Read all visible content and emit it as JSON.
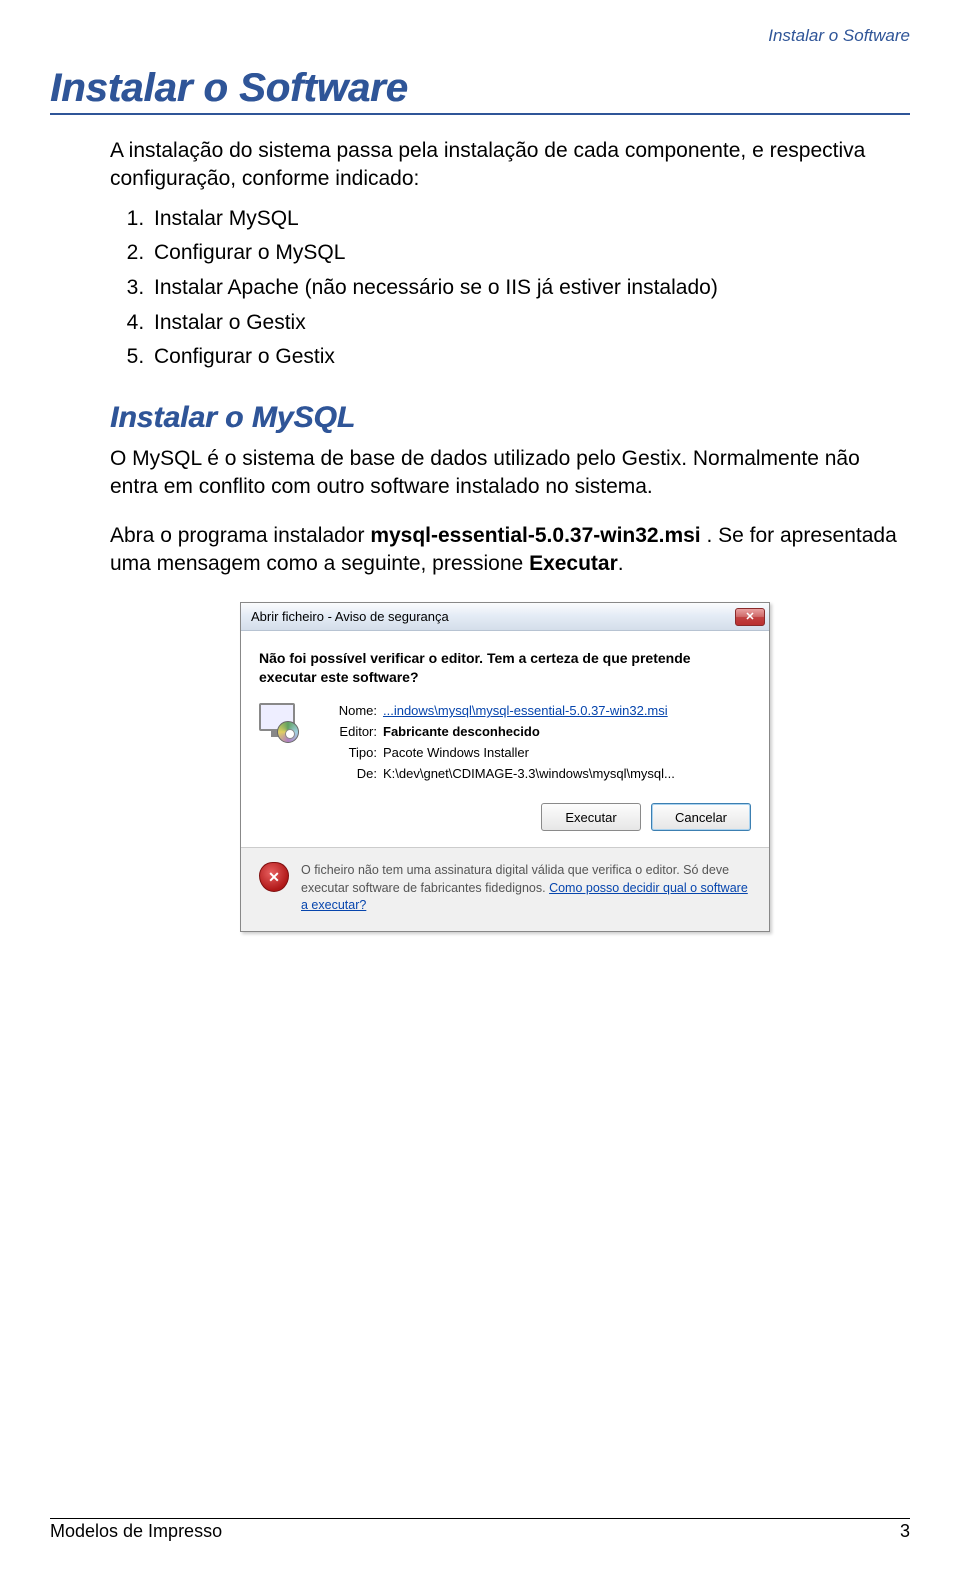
{
  "header_right": "Instalar o Software",
  "h1": "Instalar o Software",
  "intro": "A instalação do sistema passa pela instalação de cada componente, e respectiva configuração, conforme indicado:",
  "steps": [
    "Instalar MySQL",
    "Configurar o MySQL",
    "Instalar Apache (não necessário se o IIS já estiver instalado)",
    "Instalar o Gestix",
    "Configurar o Gestix"
  ],
  "h2": "Instalar o MySQL",
  "para1": "O MySQL é o sistema de base de dados utilizado pelo Gestix. Normalmente não entra em conflito com outro software instalado no sistema.",
  "para2_pre": "Abra o programa instalador ",
  "para2_bold1": "mysql-essential-5.0.37-win32.msi",
  "para2_mid": " . Se for apresentada uma mensagem como a seguinte, pressione ",
  "para2_bold2": "Executar",
  "para2_end": ".",
  "dialog": {
    "title": "Abrir ficheiro - Aviso de segurança",
    "heading": "Não foi possível verificar o editor. Tem a certeza de que pretende executar este software?",
    "labels": {
      "nome": "Nome:",
      "editor": "Editor:",
      "tipo": "Tipo:",
      "de": "De:"
    },
    "values": {
      "nome": "...indows\\mysql\\mysql-essential-5.0.37-win32.msi",
      "editor": "Fabricante desconhecido",
      "tipo": "Pacote Windows Installer",
      "de": "K:\\dev\\gnet\\CDIMAGE-3.3\\windows\\mysql\\mysql..."
    },
    "btn_run": "Executar",
    "btn_cancel": "Cancelar",
    "footer_text": "O ficheiro não tem uma assinatura digital válida que verifica o editor. Só deve executar software de fabricantes fidedignos. ",
    "footer_link": "Como posso decidir qual o software a executar?"
  },
  "footer_left": "Modelos de Impresso",
  "footer_right": "3"
}
